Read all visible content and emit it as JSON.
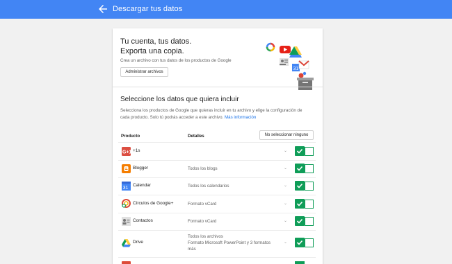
{
  "header": {
    "title": "Descargar tus datos",
    "accent_color": "#4285f4",
    "back_icon": "arrow-back-icon"
  },
  "intro": {
    "heading_line1": "Tu cuenta, tus datos.",
    "heading_line2": "Exporta una copia.",
    "subtitle": "Crea un archivo con tus datos de los productos de Google",
    "manage_button": "Administrar archivos"
  },
  "select": {
    "heading": "Seleccione los datos que quiera incluir",
    "description_line1": "Selecciona los productos de Google que quieras incluir en tu archivo y elige la configuración de",
    "description_line2": "cada producto. Solo tú podrás acceder a este archivo.",
    "more_info_link": "Más información",
    "col_product": "Producto",
    "col_details": "Detalles",
    "deselect_all_button": "No seleccionar ninguno"
  },
  "products": [
    {
      "name": "+1s",
      "details_1": "",
      "details_2": "",
      "details_3": "",
      "icon": "google-plus-one-icon",
      "selected": true
    },
    {
      "name": "Blogger",
      "details_1": "Todos los blogs",
      "details_2": "",
      "details_3": "",
      "icon": "blogger-icon",
      "selected": true
    },
    {
      "name": "Calendar",
      "details_1": "Todos los calendarios",
      "details_2": "",
      "details_3": "",
      "icon": "calendar-icon",
      "selected": true
    },
    {
      "name": "Círculos de Google+",
      "details_1": "Formato vCard",
      "details_2": "",
      "details_3": "",
      "icon": "google-circles-icon",
      "selected": true
    },
    {
      "name": "Contactos",
      "details_1": "Formato vCard",
      "details_2": "",
      "details_3": "",
      "icon": "contacts-icon",
      "selected": true
    },
    {
      "name": "Drive",
      "details_1": "Todos los archivos",
      "details_2": "Formato Microsoft PowerPoint y 3 formatos",
      "details_3": "más",
      "icon": "drive-icon",
      "selected": true
    }
  ],
  "toggle_color": "#0f9d58"
}
